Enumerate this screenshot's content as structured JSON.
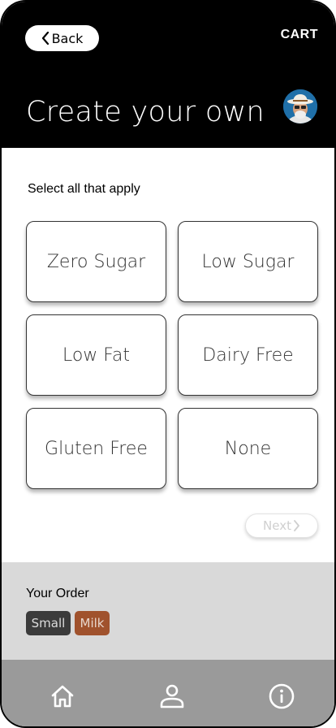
{
  "header": {
    "back_label": "Back",
    "cart_label": "CART",
    "title": "Create your own"
  },
  "prompt": "Select all that apply",
  "options": [
    {
      "label": "Zero Sugar"
    },
    {
      "label": "Low Sugar"
    },
    {
      "label": "Low Fat"
    },
    {
      "label": "Dairy Free"
    },
    {
      "label": "Gluten Free"
    },
    {
      "label": "None"
    }
  ],
  "next_label": "Next",
  "order": {
    "title": "Your Order",
    "chips": [
      {
        "label": "Small",
        "color": "#3b3b3b"
      },
      {
        "label": "Milk",
        "color": "#a0522d"
      }
    ]
  },
  "nav": {
    "icons": [
      "home-icon",
      "user-icon",
      "info-icon"
    ]
  },
  "colors": {
    "header_bg": "#000000",
    "order_bg": "#d9d9d9",
    "nav_bg": "#9a9a9a"
  }
}
